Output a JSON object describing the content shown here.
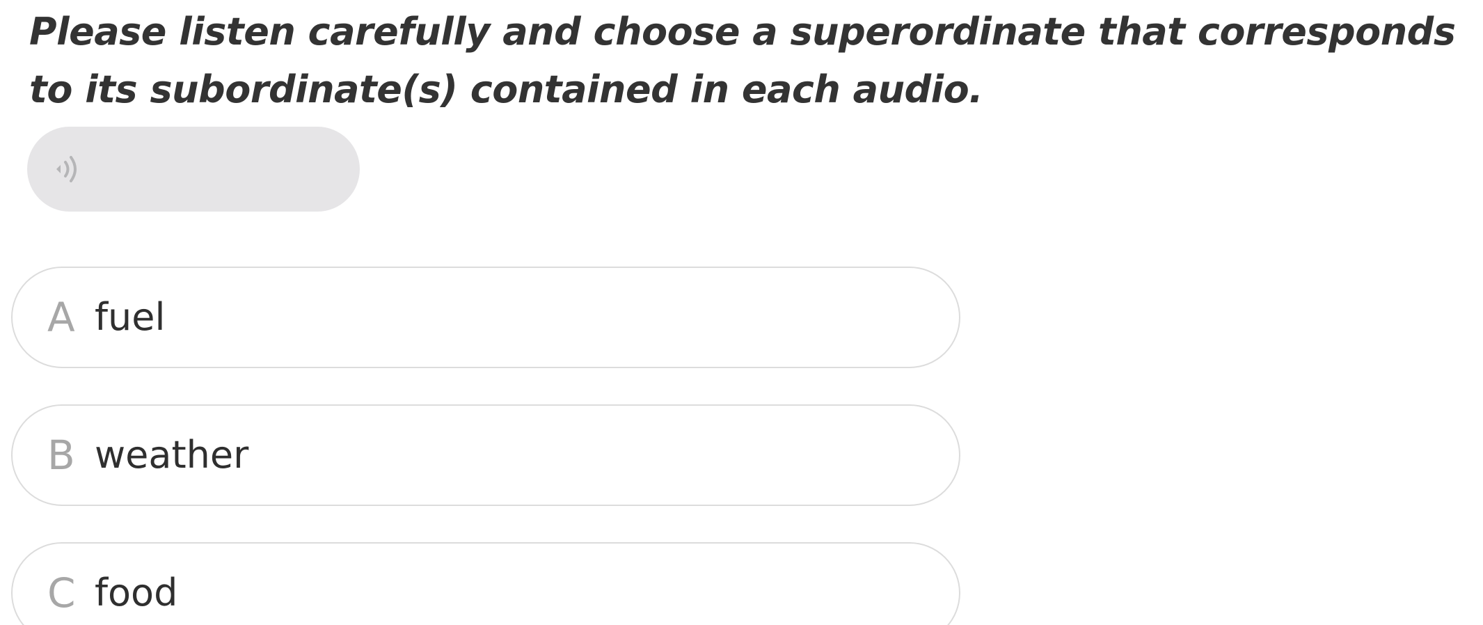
{
  "question": {
    "text": "Please listen carefully and choose a superordinate that corresponds to its subordinate(s) contained in each audio."
  },
  "audio": {
    "icon": "speaker-wave-icon"
  },
  "options": [
    {
      "letter": "A",
      "text": "fuel"
    },
    {
      "letter": "B",
      "text": "weather"
    },
    {
      "letter": "C",
      "text": "food"
    }
  ]
}
